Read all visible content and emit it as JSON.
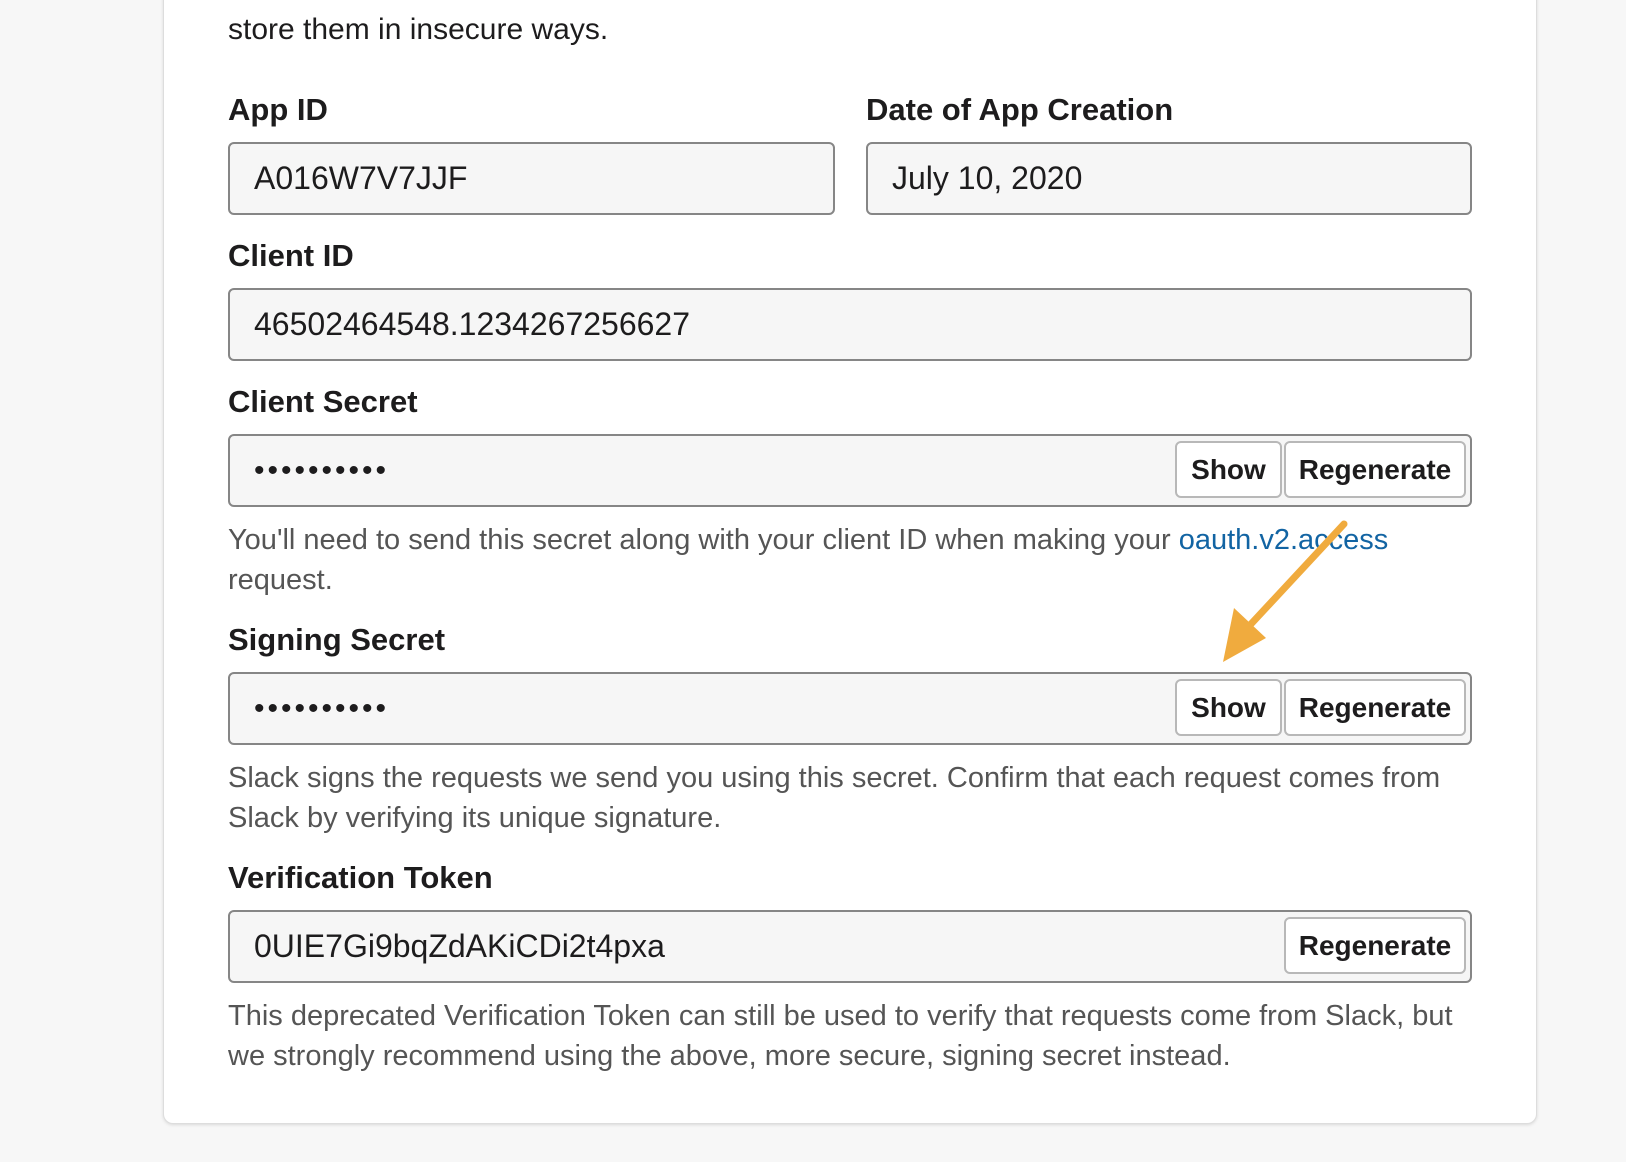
{
  "intro_text": "store them in insecure ways.",
  "app_id": {
    "label": "App ID",
    "value": "A016W7V7JJF"
  },
  "date_created": {
    "label": "Date of App Creation",
    "value": "July 10, 2020"
  },
  "client_id": {
    "label": "Client ID",
    "value": "46502464548.1234267256627"
  },
  "client_secret": {
    "label": "Client Secret",
    "masked_value": "••••••••••",
    "show_label": "Show",
    "regenerate_label": "Regenerate",
    "help_before": "You'll need to send this secret along with your client ID when making your ",
    "help_link": "oauth.v2.access",
    "help_after": "request."
  },
  "signing_secret": {
    "label": "Signing Secret",
    "masked_value": "••••••••••",
    "show_label": "Show",
    "regenerate_label": "Regenerate",
    "help_line1": "Slack signs the requests we send you using this secret. Confirm that each request comes from",
    "help_line2": "Slack by verifying its unique signature."
  },
  "verification_token": {
    "label": "Verification Token",
    "value": "0UIE7Gi9bqZdAKiCDi2t4pxa",
    "regenerate_label": "Regenerate",
    "help_line1": "This deprecated Verification Token can still be used to verify that requests come from Slack, but",
    "help_line2": "we strongly recommend using the above, more secure, signing secret instead."
  },
  "colors": {
    "annotation_arrow": "#f0ab3e",
    "link": "#1264a3"
  }
}
